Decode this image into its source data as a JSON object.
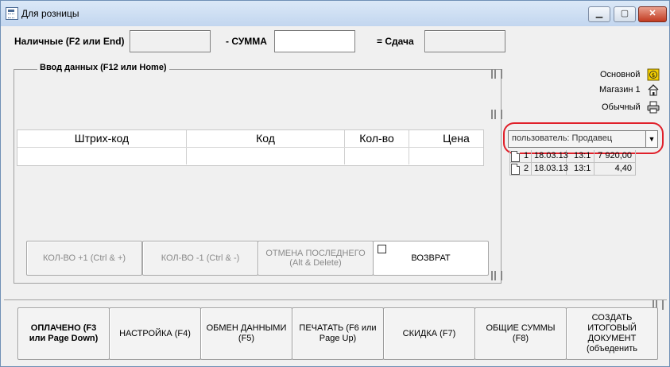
{
  "window": {
    "title": "Для розницы",
    "controls": [
      "minimize",
      "maximize",
      "close"
    ]
  },
  "payment": {
    "cash_label": "Наличные (F2 или End)",
    "cash_value": "",
    "sum_label": "- СУММА",
    "sum_value": "",
    "change_label": "= Сдача",
    "change_value": ""
  },
  "entry_group": {
    "title": "Ввод данных (F12 или Home)"
  },
  "table": {
    "columns": [
      "Штрих-код",
      "Код",
      "Кол-во",
      "Цена"
    ],
    "rows": [
      [
        "",
        "",
        "",
        ""
      ]
    ]
  },
  "qty_buttons": [
    {
      "label": "КОЛ-ВО +1     (Ctrl & +)"
    },
    {
      "label": "КОЛ-ВО -1     (Ctrl & -)"
    },
    {
      "label": "ОТМЕНА ПОСЛЕДНЕГО (Alt & Delete)"
    },
    {
      "label": "ВОЗВРАТ"
    }
  ],
  "return_checked": false,
  "side_info": [
    {
      "label": "Основной",
      "icon": "coin-icon"
    },
    {
      "label": "Магазин 1",
      "icon": "house-icon"
    },
    {
      "label": "Обычный",
      "icon": "printer-icon"
    }
  ],
  "user_combo": {
    "value": "пользователь: Продавец"
  },
  "documents": [
    {
      "num": "1",
      "date": "18.03.13",
      "time": "13:1",
      "amount": "7 920,00"
    },
    {
      "num": "2",
      "date": "18.03.13",
      "time": "13:1",
      "amount": "4,40"
    }
  ],
  "bottom_buttons": [
    {
      "label_line1": "ОПЛАЧЕНО (F3",
      "label_line2": "или Page Down)",
      "label_line3": ""
    },
    {
      "label_line1": "НАСТРОЙКА (F4)",
      "label_line2": "",
      "label_line3": ""
    },
    {
      "label_line1": "ОБМЕН ДАННЫМИ",
      "label_line2": "(F5)",
      "label_line3": ""
    },
    {
      "label_line1": "ПЕЧАТАТЬ (F6 или",
      "label_line2": "Page Up)",
      "label_line3": ""
    },
    {
      "label_line1": "СКИДКА (F7)",
      "label_line2": "",
      "label_line3": ""
    },
    {
      "label_line1": "ОБЩИЕ СУММЫ",
      "label_line2": "(F8)",
      "label_line3": ""
    },
    {
      "label_line1": "СОЗДАТЬ ИТОГОВЫЙ",
      "label_line2": "ДОКУМЕНТ",
      "label_line3": "(объеденить"
    }
  ],
  "colors": {
    "highlight_ring": "#e0202a",
    "titlebar": "#c2d6ef"
  }
}
